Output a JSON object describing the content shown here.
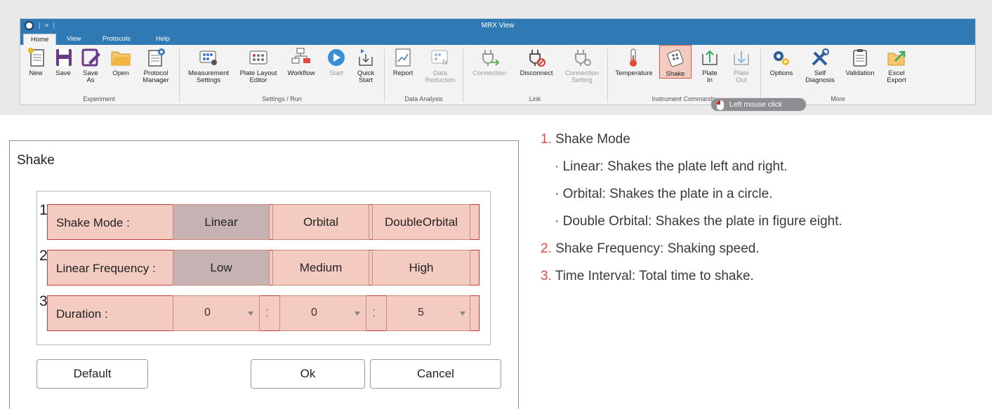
{
  "window": {
    "title": "MRX View",
    "quick_access": "| ≡ |"
  },
  "tabs": [
    {
      "label": "Home",
      "active": true
    },
    {
      "label": "View"
    },
    {
      "label": "Protocols"
    },
    {
      "label": "Help"
    }
  ],
  "ribbon": {
    "buttons": [
      {
        "label": "New",
        "icon": "new-document-icon"
      },
      {
        "label": "Save",
        "icon": "save-disk-icon"
      },
      {
        "label": "Save As",
        "icon": "save-as-icon"
      },
      {
        "label": "Open",
        "icon": "folder-open-icon"
      },
      {
        "label": "Protocol Manager",
        "icon": "protocol-manager-icon"
      },
      {
        "label": "Measurement Settings",
        "icon": "measurement-settings-icon"
      },
      {
        "label": "Plate Layout Editor",
        "icon": "plate-layout-icon"
      },
      {
        "label": "Workflow",
        "icon": "workflow-icon"
      },
      {
        "label": "Start",
        "icon": "play-icon",
        "disabled": true
      },
      {
        "label": "Quick Start",
        "icon": "quick-start-icon"
      },
      {
        "label": "Report",
        "icon": "report-chart-icon"
      },
      {
        "label": "Data Reduction",
        "icon": "data-reduction-icon",
        "disabled": true
      },
      {
        "label": "Connection",
        "icon": "plug-connect-icon",
        "disabled": true
      },
      {
        "label": "Disconnect",
        "icon": "plug-disconnect-icon"
      },
      {
        "label": "Connection Setting",
        "icon": "connection-setting-icon",
        "disabled": true
      },
      {
        "label": "Temperature",
        "icon": "thermometer-icon"
      },
      {
        "label": "Shake",
        "icon": "shake-plate-icon",
        "highlighted": true
      },
      {
        "label": "Plate In",
        "icon": "plate-in-icon"
      },
      {
        "label": "Plate Out",
        "icon": "plate-out-icon",
        "disabled": true
      },
      {
        "label": "Options",
        "icon": "gears-icon"
      },
      {
        "label": "Self Diagnosis",
        "icon": "tools-icon"
      },
      {
        "label": "Validation",
        "icon": "clipboard-icon"
      },
      {
        "label": "Excel Export",
        "icon": "excel-export-icon"
      }
    ],
    "groups": [
      {
        "label": "Experiment"
      },
      {
        "label": "Settings / Run"
      },
      {
        "label": "Data Analysis"
      },
      {
        "label": "Link"
      },
      {
        "label": "Instrument Commands"
      },
      {
        "label": "More"
      }
    ],
    "tooltip": "Left mouse click"
  },
  "dialog": {
    "title": "Shake",
    "rows": [
      {
        "num": "1",
        "label": "Shake Mode :",
        "options": [
          "Linear",
          "Orbital",
          "DoubleOrbital"
        ],
        "selected": "Linear"
      },
      {
        "num": "2",
        "label": "Linear Frequency :",
        "options": [
          "Low",
          "Medium",
          "High"
        ],
        "selected": "Low"
      },
      {
        "num": "3",
        "label": "Duration :",
        "values": [
          "0",
          "0",
          "5"
        ],
        "separator": ":"
      }
    ],
    "buttons": {
      "default": "Default",
      "ok": "Ok",
      "cancel": "Cancel"
    }
  },
  "notes": {
    "item1": {
      "num": "1.",
      "text": "Shake Mode"
    },
    "bullets": [
      "· Linear: Shakes the plate left and right.",
      "· Orbital: Shakes the plate in a circle.",
      "· Double Orbital: Shakes the plate in figure eight."
    ],
    "item2": {
      "num": "2.",
      "text": "Shake Frequency: Shaking speed."
    },
    "item3": {
      "num": "3.",
      "text": "Time Interval: Total time to shake."
    }
  },
  "colors": {
    "titlebar": "#2f7ab5",
    "highlight_fill": "#f4cbc0",
    "highlight_border": "#c73a3a",
    "selected_option": "#c7b2b3",
    "note_number": "#d94b3e"
  }
}
